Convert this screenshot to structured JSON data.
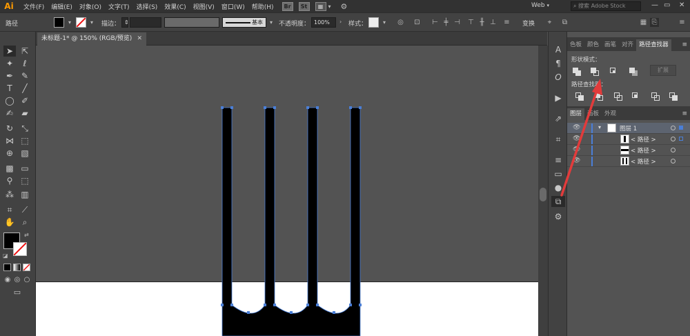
{
  "app": {
    "logo": "Ai"
  },
  "menubar": {
    "items": [
      "文件(F)",
      "编辑(E)",
      "对象(O)",
      "文字(T)",
      "选择(S)",
      "效果(C)",
      "视图(V)",
      "窗口(W)",
      "帮助(H)"
    ],
    "bridge_label": "Br",
    "stock_label": "St",
    "workspace": "Web",
    "search_placeholder": "搜索 Adobe Stock"
  },
  "control_bar": {
    "selection_type": "路径",
    "stroke_label": "描边：",
    "stroke_style": "基本",
    "opacity_label": "不透明度：",
    "opacity_value": "100%",
    "style_label": "样式：",
    "transform_label": "变换"
  },
  "document": {
    "tab_title": "未标题-1* @ 150% (RGB/预览)"
  },
  "pathfinder_panel": {
    "tabs": [
      "色板",
      "颜色",
      "画笔",
      "对齐",
      "路径查找器"
    ],
    "shape_modes_label": "形状模式：",
    "expand_label": "扩展",
    "pathfinders_label": "路径查找器："
  },
  "layers_panel": {
    "tabs": [
      "图层",
      "画板",
      "外观"
    ],
    "rows": [
      {
        "name": "图层 1"
      },
      {
        "name": "< 路径 >"
      },
      {
        "name": "< 路径 >"
      },
      {
        "name": "< 路径 >"
      }
    ]
  },
  "colors": {
    "accent": "#4a7fd8",
    "annotation_arrow": "#e23b3b",
    "artwork_fill": "#000000",
    "artboard": "#ffffff"
  }
}
